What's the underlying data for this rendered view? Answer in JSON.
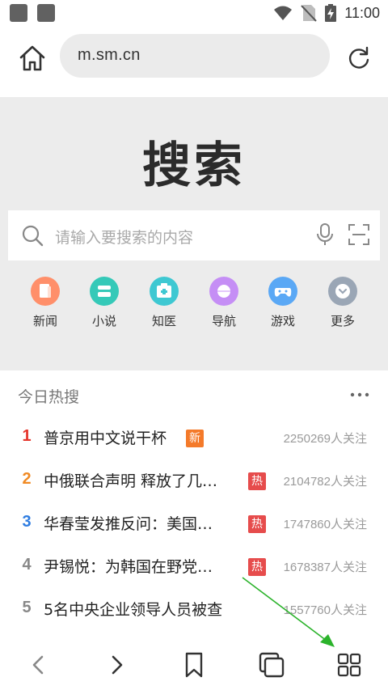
{
  "status_bar": {
    "time": "11:00",
    "icons": [
      "notification-square-icon",
      "notification-square-icon",
      "wifi-icon",
      "no-sim-icon",
      "battery-charging-icon"
    ]
  },
  "address_bar": {
    "url": "m.sm.cn",
    "home_icon": "home-icon",
    "refresh_icon": "refresh-icon"
  },
  "search": {
    "logo_text": "搜索",
    "placeholder": "请输入要搜索的内容",
    "icons": [
      "search-icon",
      "microphone-icon",
      "scan-icon"
    ]
  },
  "quick_links": [
    {
      "label": "新闻",
      "icon": "news-icon",
      "color": "#ff8f6a"
    },
    {
      "label": "小说",
      "icon": "novel-icon",
      "color": "#35c9b8"
    },
    {
      "label": "知医",
      "icon": "medical-icon",
      "color": "#3ec8d2"
    },
    {
      "label": "导航",
      "icon": "navigation-icon",
      "color": "#c58ef5"
    },
    {
      "label": "游戏",
      "icon": "game-icon",
      "color": "#5aa8f5"
    },
    {
      "label": "更多",
      "icon": "more-chevron-icon",
      "color": "#9aa6b5"
    }
  ],
  "hot": {
    "title": "今日热搜",
    "more_icon": "more-dots-icon",
    "items": [
      {
        "rank": "1",
        "text": "普京用中文说干杯",
        "badge": "新",
        "count": "2250269人关注",
        "rank_color": "#e5352b"
      },
      {
        "rank": "2",
        "text": "中俄联合声明 释放了几…",
        "badge": "热",
        "count": "2104782人关注",
        "rank_color": "#f08a24"
      },
      {
        "rank": "3",
        "text": "华春莹发推反问：美国…",
        "badge": "热",
        "count": "1747860人关注",
        "rank_color": "#2f7de1"
      },
      {
        "rank": "4",
        "text": "尹锡悦：为韩国在野党…",
        "badge": "热",
        "count": "1678387人关注",
        "rank_color": "#888888"
      },
      {
        "rank": "5",
        "text": "5名中央企业领导人员被查",
        "badge": "",
        "count": "1557760人关注",
        "rank_color": "#888888"
      }
    ]
  },
  "bottom_nav": {
    "icons": [
      "back-icon",
      "forward-icon",
      "bookmark-icon",
      "tabs-icon",
      "menu-grid-icon"
    ]
  },
  "colors": {
    "accent_green_annotation": "#2bb32b",
    "search_area_bg": "#ececec"
  }
}
